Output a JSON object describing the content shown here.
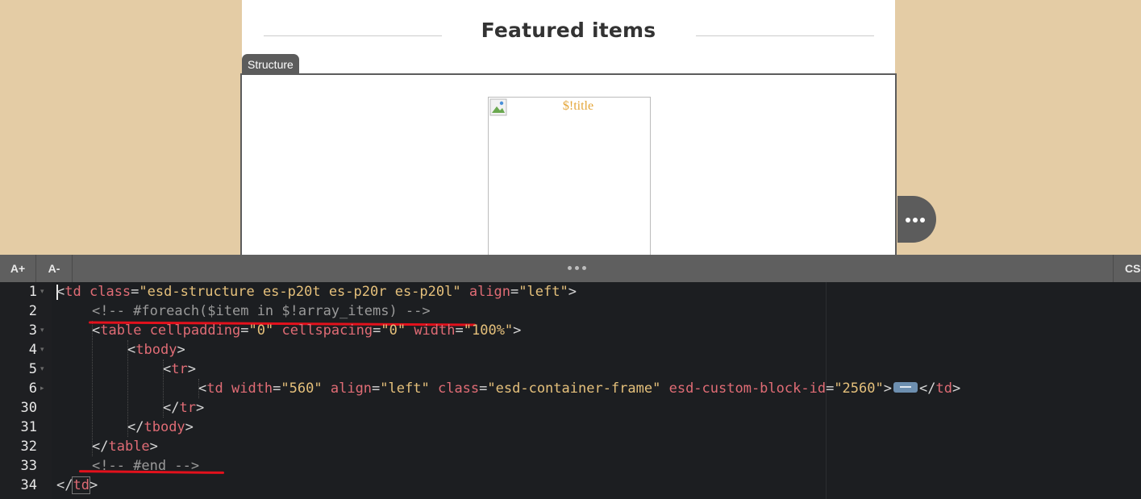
{
  "preview": {
    "section_title": "Featured items",
    "structure_tab_label": "Structure",
    "image_alt_text": "$!title"
  },
  "toolbar": {
    "font_increase_label": "A+",
    "font_decrease_label": "A-",
    "css_tab_label": "CSS"
  },
  "editor": {
    "line_numbers": [
      "1",
      "2",
      "3",
      "4",
      "5",
      "6",
      "30",
      "31",
      "32",
      "33",
      "34"
    ],
    "lines": [
      {
        "n": "1",
        "tokens": [
          {
            "t": "<",
            "c": "t-pun"
          },
          {
            "t": "td",
            "c": "t-tag"
          },
          {
            "t": " ",
            "c": ""
          },
          {
            "t": "class",
            "c": "t-attr"
          },
          {
            "t": "=",
            "c": "t-eq"
          },
          {
            "t": "\"esd-structure es-p20t es-p20r es-p20l\"",
            "c": "t-str"
          },
          {
            "t": " ",
            "c": ""
          },
          {
            "t": "align",
            "c": "t-attr"
          },
          {
            "t": "=",
            "c": "t-eq"
          },
          {
            "t": "\"left\"",
            "c": "t-str"
          },
          {
            "t": ">",
            "c": "t-pun"
          }
        ]
      },
      {
        "n": "2",
        "tokens": [
          {
            "t": "<!-- #foreach($item in $!array_items) -->",
            "c": "t-cmt"
          }
        ]
      },
      {
        "n": "3",
        "tokens": [
          {
            "t": "<",
            "c": "t-pun"
          },
          {
            "t": "table",
            "c": "t-tag"
          },
          {
            "t": " ",
            "c": ""
          },
          {
            "t": "cellpadding",
            "c": "t-attr"
          },
          {
            "t": "=",
            "c": "t-eq"
          },
          {
            "t": "\"0\"",
            "c": "t-str"
          },
          {
            "t": " ",
            "c": ""
          },
          {
            "t": "cellspacing",
            "c": "t-attr"
          },
          {
            "t": "=",
            "c": "t-eq"
          },
          {
            "t": "\"0\"",
            "c": "t-str"
          },
          {
            "t": " ",
            "c": ""
          },
          {
            "t": "width",
            "c": "t-attr"
          },
          {
            "t": "=",
            "c": "t-eq"
          },
          {
            "t": "\"100%\"",
            "c": "t-str"
          },
          {
            "t": ">",
            "c": "t-pun"
          }
        ]
      },
      {
        "n": "4",
        "tokens": [
          {
            "t": "<",
            "c": "t-pun"
          },
          {
            "t": "tbody",
            "c": "t-tag"
          },
          {
            "t": ">",
            "c": "t-pun"
          }
        ]
      },
      {
        "n": "5",
        "tokens": [
          {
            "t": "<",
            "c": "t-pun"
          },
          {
            "t": "tr",
            "c": "t-tag"
          },
          {
            "t": ">",
            "c": "t-pun"
          }
        ]
      },
      {
        "n": "6",
        "tokens": [
          {
            "t": "<",
            "c": "t-pun"
          },
          {
            "t": "td",
            "c": "t-tag"
          },
          {
            "t": " ",
            "c": ""
          },
          {
            "t": "width",
            "c": "t-attr"
          },
          {
            "t": "=",
            "c": "t-eq"
          },
          {
            "t": "\"560\"",
            "c": "t-str"
          },
          {
            "t": " ",
            "c": ""
          },
          {
            "t": "align",
            "c": "t-attr"
          },
          {
            "t": "=",
            "c": "t-eq"
          },
          {
            "t": "\"left\"",
            "c": "t-str"
          },
          {
            "t": " ",
            "c": ""
          },
          {
            "t": "class",
            "c": "t-attr"
          },
          {
            "t": "=",
            "c": "t-eq"
          },
          {
            "t": "\"esd-container-frame\"",
            "c": "t-str"
          },
          {
            "t": " ",
            "c": ""
          },
          {
            "t": "esd-custom-block-id",
            "c": "t-attr"
          },
          {
            "t": "=",
            "c": "t-eq"
          },
          {
            "t": "\"2560\"",
            "c": "t-str"
          },
          {
            "t": ">",
            "c": "t-pun"
          },
          {
            "t": "",
            "c": "fold-marker"
          },
          {
            "t": "</",
            "c": "t-pun"
          },
          {
            "t": "td",
            "c": "t-tag"
          },
          {
            "t": ">",
            "c": "t-pun"
          }
        ]
      },
      {
        "n": "30",
        "tokens": [
          {
            "t": "</",
            "c": "t-pun"
          },
          {
            "t": "tr",
            "c": "t-tag"
          },
          {
            "t": ">",
            "c": "t-pun"
          }
        ]
      },
      {
        "n": "31",
        "tokens": [
          {
            "t": "</",
            "c": "t-pun"
          },
          {
            "t": "tbody",
            "c": "t-tag"
          },
          {
            "t": ">",
            "c": "t-pun"
          }
        ]
      },
      {
        "n": "32",
        "tokens": [
          {
            "t": "</",
            "c": "t-pun"
          },
          {
            "t": "table",
            "c": "t-tag"
          },
          {
            "t": ">",
            "c": "t-pun"
          }
        ]
      },
      {
        "n": "33",
        "tokens": [
          {
            "t": "<!-- #end -->",
            "c": "t-cmt"
          }
        ]
      },
      {
        "n": "34",
        "tokens": [
          {
            "t": "</",
            "c": "t-pun"
          },
          {
            "t": "td",
            "c": "t-tag"
          },
          {
            "t": ">",
            "c": "t-pun"
          }
        ]
      }
    ]
  },
  "colors": {
    "page_background": "#e4cca5",
    "editor_background": "#1c1e21",
    "toolbar_background": "#5f5f5f",
    "tag_color": "#e06c75",
    "string_color": "#e5c07b",
    "comment_color": "#9a9a9a",
    "annotation_underline": "#e3111c"
  }
}
